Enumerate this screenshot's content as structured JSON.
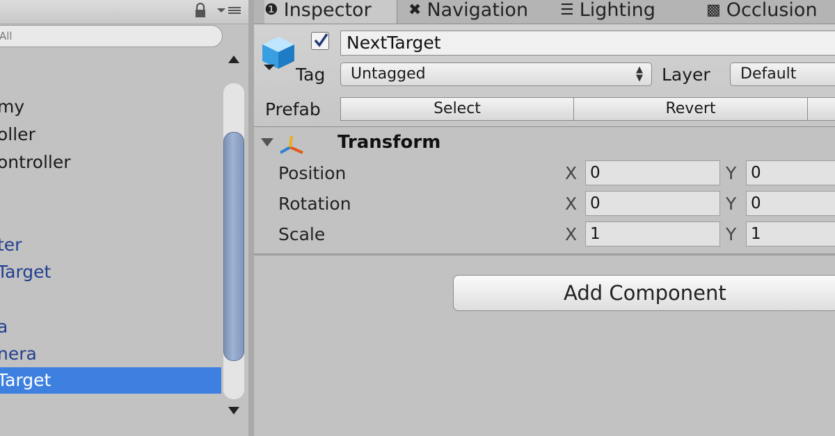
{
  "hierarchy": {
    "search_placeholder": "All",
    "items": [
      {
        "label": "my",
        "kind": "normal"
      },
      {
        "label": "oller",
        "kind": "normal"
      },
      {
        "label": "ontroller",
        "kind": "normal"
      },
      {
        "label": "",
        "kind": "normal"
      },
      {
        "label": "",
        "kind": "normal"
      },
      {
        "label": "ter",
        "kind": "prefab"
      },
      {
        "label": "Target",
        "kind": "prefab"
      },
      {
        "label": "",
        "kind": "normal"
      },
      {
        "label": "a",
        "kind": "prefab"
      },
      {
        "label": "nera",
        "kind": "prefab"
      },
      {
        "label": "Target",
        "kind": "selected"
      }
    ]
  },
  "tabs": [
    {
      "label": "Inspector",
      "icon": "info-icon",
      "active": true
    },
    {
      "label": "Navigation",
      "icon": "navigation-icon",
      "active": false
    },
    {
      "label": "Lighting",
      "icon": "lighting-icon",
      "active": false
    },
    {
      "label": "Occlusion",
      "icon": "occlusion-icon",
      "active": false
    }
  ],
  "inspector": {
    "object_name": "NextTarget",
    "active_checked": true,
    "tag_label": "Tag",
    "tag_value": "Untagged",
    "layer_label": "Layer",
    "layer_value": "Default",
    "prefab_label": "Prefab",
    "prefab_select": "Select",
    "prefab_revert": "Revert",
    "transform": {
      "title": "Transform",
      "rows": [
        {
          "label": "Position",
          "x": "0",
          "y": "0"
        },
        {
          "label": "Rotation",
          "x": "0",
          "y": "0"
        },
        {
          "label": "Scale",
          "x": "1",
          "y": "1"
        }
      ],
      "axis_x": "X",
      "axis_y": "Y"
    },
    "add_component": "Add Component"
  },
  "colors": {
    "selection": "#3d80e0",
    "prefab_text": "#213f8f",
    "panel_bg": "#c2c2c2"
  }
}
